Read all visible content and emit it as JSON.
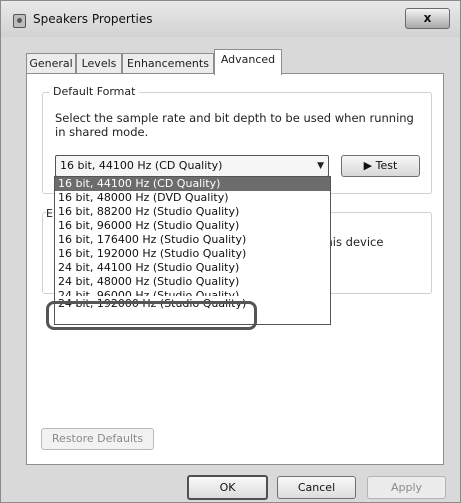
{
  "window": {
    "title": "Speakers Properties",
    "close_label": "x"
  },
  "tabs": [
    {
      "label": "General"
    },
    {
      "label": "Levels"
    },
    {
      "label": "Enhancements"
    },
    {
      "label": "Advanced",
      "active": true
    }
  ],
  "default_format": {
    "legend": "Default Format",
    "description": "Select the sample rate and bit depth to be used when running in shared mode.",
    "selected_value": "16 bit, 44100 Hz (CD Quality)",
    "test_label": "Test"
  },
  "exclusive_mode": {
    "legend_fragment": "E",
    "text_fragment": "this device"
  },
  "dropdown_options": [
    "16 bit, 44100 Hz (CD Quality)",
    "16 bit, 48000 Hz (DVD Quality)",
    "16 bit, 88200 Hz (Studio Quality)",
    "16 bit, 96000 Hz (Studio Quality)",
    "16 bit, 176400 Hz (Studio Quality)",
    "16 bit, 192000 Hz (Studio Quality)",
    "24 bit, 44100 Hz (Studio Quality)",
    "24 bit, 48000 Hz (Studio Quality)",
    "24 bit, 96000 Hz (Studio Quality)",
    "24 bit, 192000 Hz (Studio Quality)"
  ],
  "buttons": {
    "restore": "Restore Defaults",
    "ok": "OK",
    "cancel": "Cancel",
    "apply": "Apply"
  },
  "colors": {
    "selected_option_bg": "#6c6c6c",
    "highlight_ring": "#555555"
  }
}
